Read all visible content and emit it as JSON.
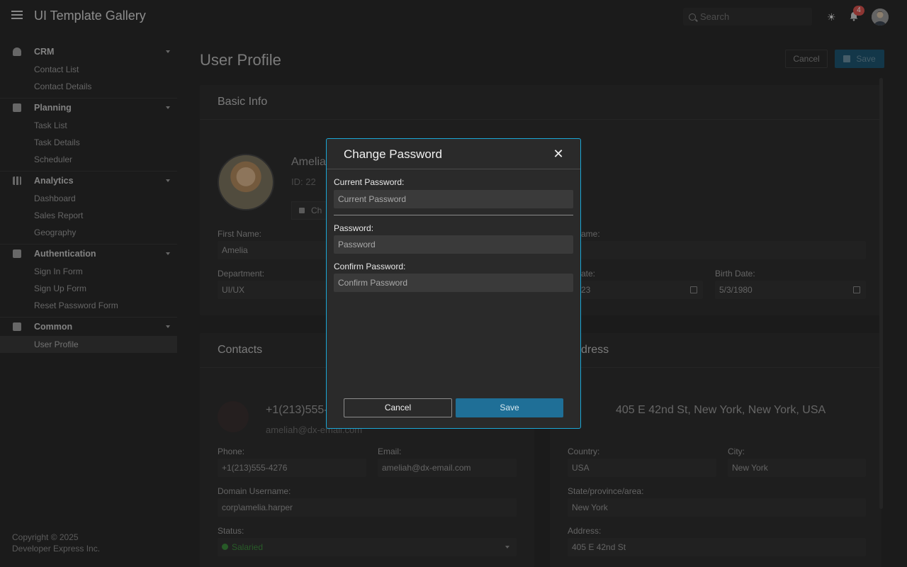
{
  "header": {
    "app_title": "UI Template Gallery",
    "search_placeholder": "Search",
    "notification_count": "4"
  },
  "sidebar": {
    "groups": [
      {
        "label": "CRM",
        "icon": "person-icon",
        "items": [
          "Contact List",
          "Contact Details"
        ]
      },
      {
        "label": "Planning",
        "icon": "calendar-icon",
        "items": [
          "Task List",
          "Task Details",
          "Scheduler"
        ]
      },
      {
        "label": "Analytics",
        "icon": "bar-chart-icon",
        "items": [
          "Dashboard",
          "Sales Report",
          "Geography"
        ]
      },
      {
        "label": "Authentication",
        "icon": "id-badge-icon",
        "items": [
          "Sign In Form",
          "Sign Up Form",
          "Reset Password Form"
        ]
      },
      {
        "label": "Common",
        "icon": "briefcase-icon",
        "items": [
          "User Profile"
        ]
      }
    ],
    "active_item": "User Profile",
    "copyright_line1": "Copyright © 2025",
    "copyright_line2": "Developer Express Inc."
  },
  "page": {
    "title": "User Profile",
    "cancel_label": "Cancel",
    "save_label": "Save"
  },
  "basic_info": {
    "title": "Basic Info",
    "name_partial": "Amelia",
    "id_partial": "ID: 22",
    "change_btn_partial": "Ch",
    "first_name_label": "First Name:",
    "first_name_value": "Amelia",
    "last_name_label_partial": "ame:",
    "department_label": "Department:",
    "department_value": "UI/UX",
    "hire_date_label_partial": "ate:",
    "hire_date_value_partial": "23",
    "birth_date_label": "Birth Date:",
    "birth_date_value": "5/3/1980"
  },
  "contacts": {
    "title": "Contacts",
    "phone_big_partial": "+1(213)555-",
    "email_big_partial": "ameliah@dx-email.com",
    "phone_label": "Phone:",
    "phone_value": "+1(213)555-4276",
    "email_label": "Email:",
    "email_value": "ameliah@dx-email.com",
    "domain_label": "Domain Username:",
    "domain_value": "corp\\amelia.harper",
    "status_label": "Status:",
    "status_value": "Salaried"
  },
  "address": {
    "title_partial": "dress",
    "full_address": "405 E 42nd St, New York, New York, USA",
    "country_label": "Country:",
    "country_value": "USA",
    "city_label": "City:",
    "city_value": "New York",
    "state_label": "State/province/area:",
    "state_value": "New York",
    "address_label": "Address:",
    "address_value": "405 E 42nd St"
  },
  "modal": {
    "title": "Change Password",
    "current_password_label": "Current Password:",
    "current_password_placeholder": "Current Password",
    "password_label": "Password:",
    "password_placeholder": "Password",
    "confirm_password_label": "Confirm Password:",
    "confirm_password_placeholder": "Confirm Password",
    "cancel_label": "Cancel",
    "save_label": "Save"
  },
  "colors": {
    "accent": "#1ba6d6",
    "primary_button": "#1f6f97",
    "background": "#2a2a2a"
  }
}
